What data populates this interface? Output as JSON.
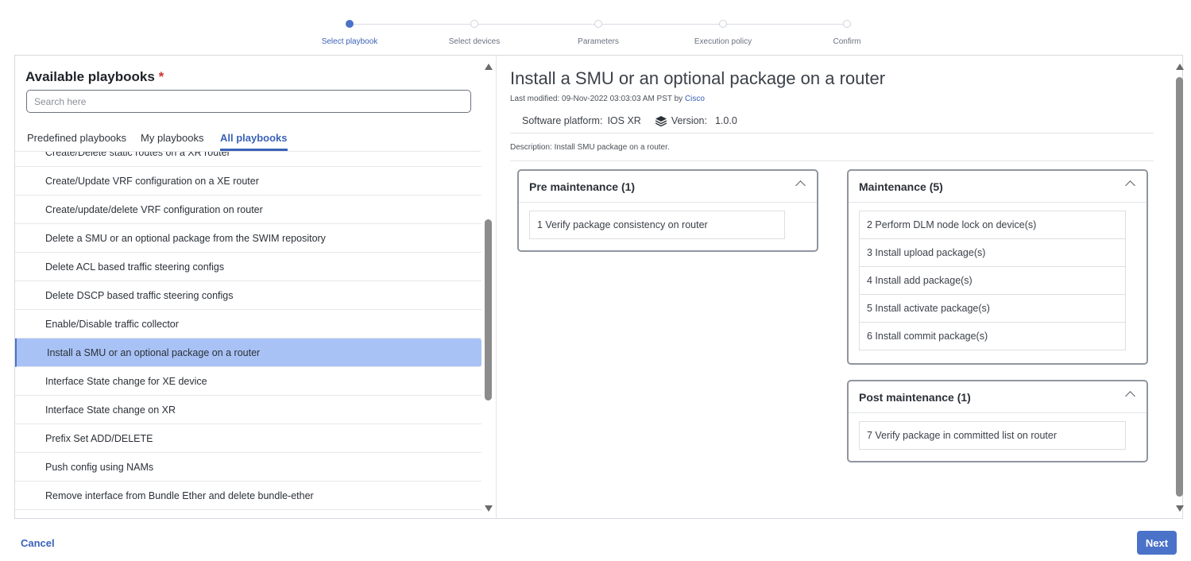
{
  "stepper": {
    "steps": [
      {
        "label": "Select playbook",
        "active": true
      },
      {
        "label": "Select devices",
        "active": false
      },
      {
        "label": "Parameters",
        "active": false
      },
      {
        "label": "Execution policy",
        "active": false
      },
      {
        "label": "Confirm",
        "active": false
      }
    ]
  },
  "left_panel": {
    "title": "Available playbooks",
    "required_mark": "*",
    "search_placeholder": "Search here",
    "tabs": [
      {
        "label": "Predefined playbooks",
        "active": false
      },
      {
        "label": "My playbooks",
        "active": false
      },
      {
        "label": "All playbooks",
        "active": true
      }
    ],
    "items": [
      "Create/Delete static routes on a XR router",
      "Create/Update VRF configuration on a XE router",
      "Create/update/delete VRF configuration on router",
      "Delete a SMU or an optional package from the SWIM repository",
      "Delete ACL based traffic steering configs",
      "Delete DSCP based traffic steering configs",
      "Enable/Disable traffic collector",
      "Install a SMU or an optional package on a router",
      "Interface State change for XE device",
      "Interface State change on XR",
      "Prefix Set ADD/DELETE",
      "Push config using NAMs",
      "Remove interface from Bundle Ether and delete bundle-ether"
    ],
    "selected_item": "Install a SMU or an optional package on a router"
  },
  "detail": {
    "title": "Install a SMU or an optional package on a router",
    "last_modified_prefix": "Last modified: 09-Nov-2022 03:03:03 AM PST by",
    "author": "Cisco",
    "platform_label": "Software platform:",
    "platform_value": "IOS XR",
    "version_icon": "stack-icon",
    "version_label": "Version:",
    "version_value": "1.0.0",
    "description": "Description: Install SMU package on a router.",
    "pre_maintenance": {
      "title": "Pre maintenance (1)",
      "tasks": [
        "1 Verify package consistency on router"
      ]
    },
    "maintenance": {
      "title": "Maintenance (5)",
      "tasks": [
        "2 Perform DLM node lock on device(s)",
        "3 Install upload package(s)",
        "4 Install add package(s)",
        "5 Install activate package(s)",
        "6 Install commit package(s)"
      ]
    },
    "post_maintenance": {
      "title": "Post maintenance (1)",
      "tasks": [
        "7 Verify package in committed list on router"
      ]
    }
  },
  "footer": {
    "cancel_label": "Cancel",
    "next_label": "Next"
  },
  "colors": {
    "accent": "#4a72c8",
    "selected_row": "#a9c2f5",
    "required": "#d0312d"
  }
}
